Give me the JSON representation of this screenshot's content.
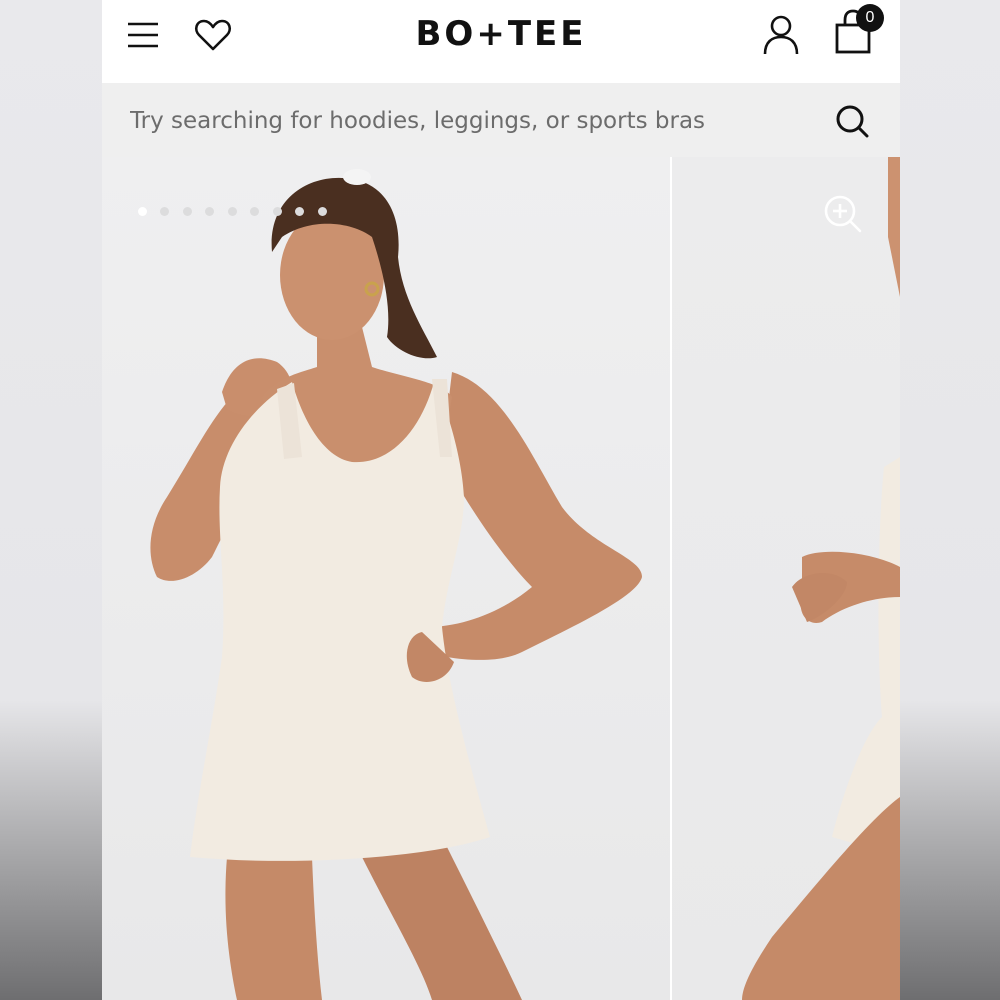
{
  "header": {
    "logo": "BO+TEE",
    "cart_count": "0"
  },
  "search": {
    "placeholder": "Try searching for hoodies, leggings, or sports bras"
  },
  "gallery": {
    "slide_count": 9,
    "active_index": 0
  },
  "icons": {
    "menu": "hamburger-menu-icon",
    "wishlist": "heart-icon",
    "account": "user-icon",
    "cart": "shopping-bag-icon",
    "search": "search-icon",
    "zoom": "zoom-in-icon"
  },
  "colors": {
    "brand_text": "#111111",
    "search_bg": "#efefef",
    "dress": "#f2ebe1",
    "skin": "#c58a68",
    "hair": "#4a2f20"
  }
}
